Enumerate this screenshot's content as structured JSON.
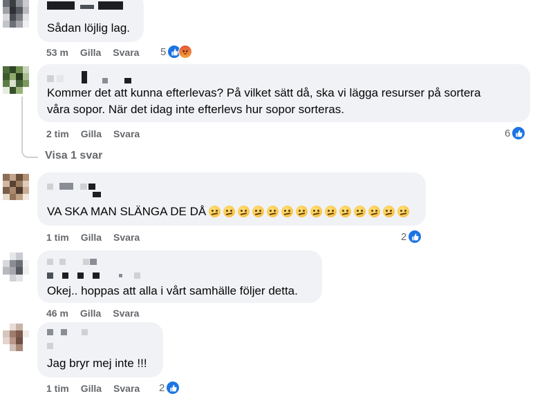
{
  "comments": [
    {
      "text": "Sådan löjlig lag.",
      "time": "53 m",
      "like_label": "Gilla",
      "reply_label": "Svara",
      "reaction_count": "5",
      "reactions": [
        "like-icon",
        "angry-icon"
      ]
    },
    {
      "text_line1": "Kommer det att kunna efterlevas? På vilket sätt då, ska vi lägga resurser på sortera",
      "text_line2": "våra sopor. När det idag inte efterlevs hur sopor sorteras.",
      "time": "2 tim",
      "like_label": "Gilla",
      "reply_label": "Svara",
      "reaction_count": "6",
      "reactions": [
        "like-icon"
      ]
    },
    {
      "text": "VA SKA MAN SLÄNGA DE DÅ",
      "emoji_count": 14,
      "emoji": "confused-face",
      "time": "1 tim",
      "like_label": "Gilla",
      "reply_label": "Svara",
      "reaction_count": "2",
      "reactions": [
        "like-icon"
      ]
    },
    {
      "text": "Okej.. hoppas att alla i vårt samhälle följer detta.",
      "time": "46 m",
      "like_label": "Gilla",
      "reply_label": "Svara"
    },
    {
      "text": "Jag bryr mej inte !!!",
      "time": "1 tim",
      "like_label": "Gilla",
      "reply_label": "Svara",
      "reaction_count": "2",
      "reactions": [
        "like-icon"
      ]
    }
  ],
  "thread": {
    "show_replies_label": "Visa 1 svar"
  },
  "colors": {
    "bubble": "#f0f2f5",
    "meta": "#65676b",
    "like": "#1b74e4"
  }
}
